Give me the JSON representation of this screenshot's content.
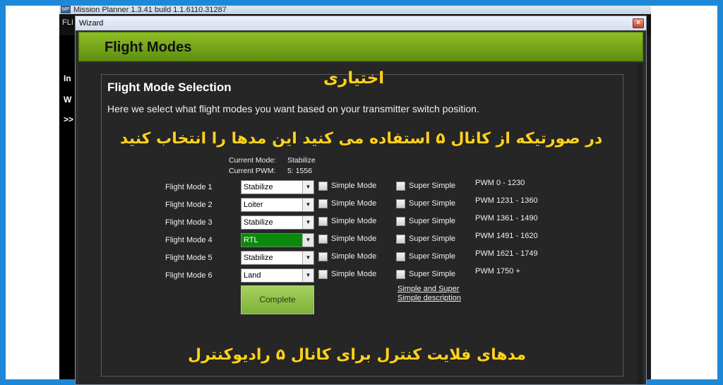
{
  "app": {
    "title": "Mission Planner 1.3.41 build 1.1.6110.31287",
    "icon_label": "MP",
    "menu_first": "FLI",
    "left_text": [
      "In",
      "W",
      ">>"
    ]
  },
  "wizard": {
    "title": "Wizard",
    "close_label": "×",
    "header_title": "Flight Modes"
  },
  "selection": {
    "title": "Flight Mode Selection",
    "description": "Here we select what flight modes you want based on your transmitter switch position."
  },
  "overlay": {
    "optional": "اختیاری",
    "instruction": "در صورتیکه از کانال ۵ استفاده می کنید این مدها را انتخاب کنید",
    "bottom": "مدهای فلایت کنترل برای کانال ۵ رادیوکنترل"
  },
  "status": {
    "current_mode_label": "Current Mode:",
    "current_mode_value": "Stabilize",
    "current_pwm_label": "Current PWM:",
    "current_pwm_value": "5: 1556"
  },
  "modes": [
    {
      "label": "Flight Mode 1",
      "value": "Stabilize",
      "simple": "Simple Mode",
      "super": "Super Simple",
      "pwm": "PWM 0 - 1230",
      "active": false
    },
    {
      "label": "Flight Mode 2",
      "value": "Loiter",
      "simple": "Simple Mode",
      "super": "Super Simple",
      "pwm": "PWM 1231 - 1360",
      "active": false
    },
    {
      "label": "Flight Mode 3",
      "value": "Stabilize",
      "simple": "Simple Mode",
      "super": "Super Simple",
      "pwm": "PWM 1361 - 1490",
      "active": false
    },
    {
      "label": "Flight Mode 4",
      "value": "RTL",
      "simple": "Simple Mode",
      "super": "Super Simple",
      "pwm": "PWM 1491 - 1620",
      "active": true
    },
    {
      "label": "Flight Mode 5",
      "value": "Stabilize",
      "simple": "Simple Mode",
      "super": "Super Simple",
      "pwm": "PWM 1621 - 1749",
      "active": false
    },
    {
      "label": "Flight Mode 6",
      "value": "Land",
      "simple": "Simple Mode",
      "super": "Super Simple",
      "pwm": "PWM 1750 +",
      "active": false
    }
  ],
  "complete_label": "Complete",
  "simple_link_line1": "Simple and Super",
  "simple_link_line2": "Simple description",
  "colors": {
    "header_green": "#7aaa1a",
    "active_mode_green": "#0a8a0a",
    "overlay_yellow": "#ffd21e",
    "frame_blue": "#1e88d8"
  }
}
